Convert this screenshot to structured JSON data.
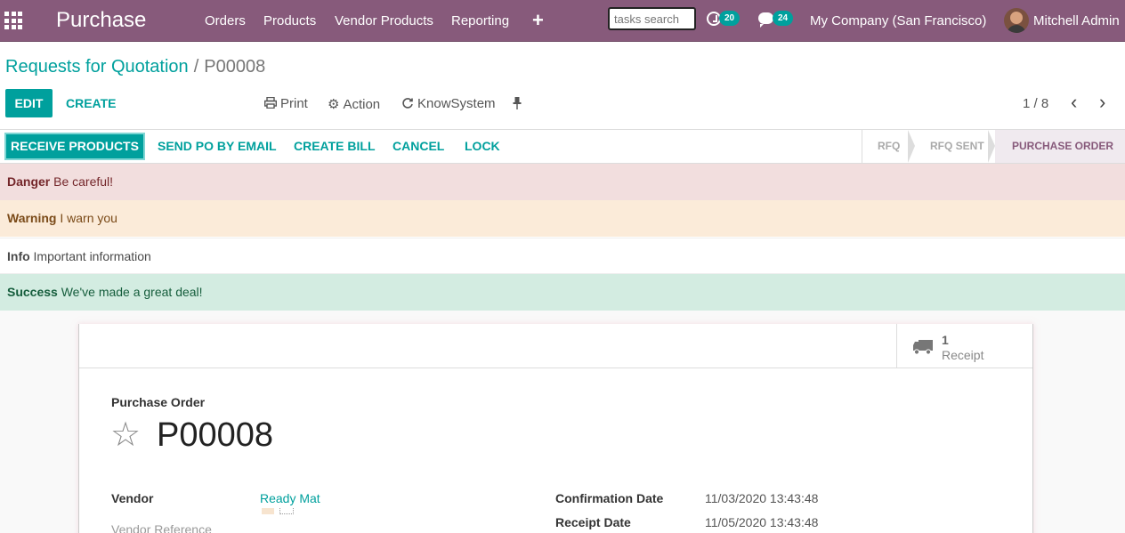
{
  "navbar": {
    "brand": "Purchase",
    "menu": [
      "Orders",
      "Products",
      "Vendor Products",
      "Reporting"
    ],
    "add_label": "+",
    "search_placeholder": "tasks search",
    "activity_count": "20",
    "messages_count": "24",
    "company": "My Company (San Francisco)",
    "user": "Mitchell Admin"
  },
  "breadcrumb": {
    "parent": "Requests for Quotation",
    "separator": "/",
    "current": "P00008"
  },
  "toolbar": {
    "edit_label": "EDIT",
    "create_label": "CREATE",
    "print_label": "Print",
    "action_label": "Action",
    "knowsystem_label": "KnowSystem",
    "pager_value": "1 / 8"
  },
  "statusbar": {
    "buttons": [
      "RECEIVE PRODUCTS",
      "SEND PO BY EMAIL",
      "CREATE BILL",
      "CANCEL",
      "LOCK"
    ],
    "stages": [
      "RFQ",
      "RFQ SENT",
      "PURCHASE ORDER"
    ],
    "active_stage": "PURCHASE ORDER"
  },
  "alerts": [
    {
      "type": "danger",
      "title": "Danger",
      "text": "Be careful!"
    },
    {
      "type": "warning",
      "title": "Warning",
      "text": "I warn you"
    },
    {
      "type": "info",
      "title": "Info",
      "text": "Important information"
    },
    {
      "type": "success",
      "title": "Success",
      "text": "We've made a great deal!"
    }
  ],
  "form": {
    "smart_button": {
      "value": "1",
      "label": "Receipt",
      "icon": "truck-icon"
    },
    "title_label": "Purchase Order",
    "name": "P00008",
    "vendor_label": "Vendor",
    "vendor_value": "Ready Mat",
    "vendor_ref_label": "Vendor Reference",
    "confirmation_label": "Confirmation Date",
    "confirmation_value": "11/03/2020 13:43:48",
    "receipt_label": "Receipt Date",
    "receipt_value": "11/05/2020 13:43:48"
  },
  "colors": {
    "brand": "#875a7b",
    "accent": "#00a09d",
    "danger_bg": "#f2dede",
    "warning_bg": "#fbebd9",
    "success_bg": "#d3ece1"
  }
}
